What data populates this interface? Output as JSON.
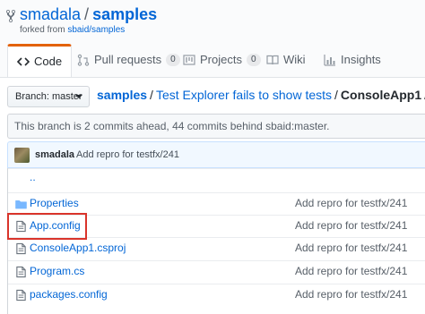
{
  "repo": {
    "owner": "smadala",
    "separator": "/",
    "name": "samples",
    "forked_prefix": "forked from ",
    "forked_from": "sbaid/samples"
  },
  "tabs": [
    {
      "label": "Code",
      "selected": true
    },
    {
      "label": "Pull requests",
      "count": "0"
    },
    {
      "label": "Projects",
      "count": "0"
    },
    {
      "label": "Wiki"
    },
    {
      "label": "Insights"
    }
  ],
  "branch": {
    "label": "Branch: master"
  },
  "breadcrumb": {
    "root": "samples",
    "middle": "Test Explorer fails to show tests",
    "current": "ConsoleApp1",
    "sep": "/"
  },
  "branch_status": "This branch is 2 commits ahead, 44 commits behind sbaid:master.",
  "latest_commit": {
    "author": "smadala",
    "message": "Add repro for testfx/241"
  },
  "files": {
    "updir": "..",
    "rows": [
      {
        "type": "folder",
        "name": "Properties",
        "message": "Add repro for testfx/241"
      },
      {
        "type": "file",
        "name": "App.config",
        "message": "Add repro for testfx/241"
      },
      {
        "type": "file",
        "name": "ConsoleApp1.csproj",
        "message": "Add repro for testfx/241"
      },
      {
        "type": "file",
        "name": "Program.cs",
        "message": "Add repro for testfx/241"
      },
      {
        "type": "file",
        "name": "packages.config",
        "message": "Add repro for testfx/241"
      }
    ]
  },
  "colors": {
    "link": "#0366d6",
    "accent": "#e36209",
    "highlight": "#d9342b"
  }
}
